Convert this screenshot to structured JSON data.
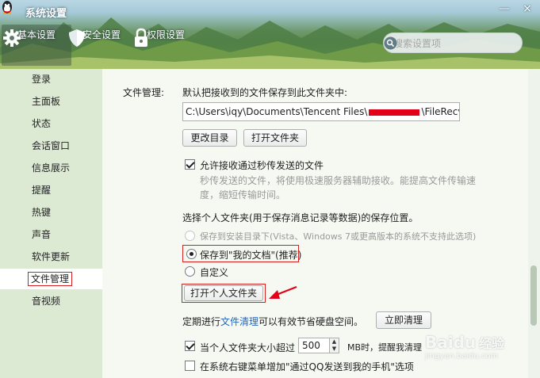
{
  "window": {
    "title": "系统设置",
    "minimize": "—",
    "close": "×"
  },
  "tabs": [
    {
      "label": "基本设置",
      "icon": "gear-icon"
    },
    {
      "label": "安全设置",
      "icon": "shield-icon"
    },
    {
      "label": "权限设置",
      "icon": "lock-icon"
    }
  ],
  "search": {
    "placeholder": "搜索设置项"
  },
  "sidebar": {
    "items": [
      {
        "label": "登录"
      },
      {
        "label": "主面板"
      },
      {
        "label": "状态"
      },
      {
        "label": "会话窗口"
      },
      {
        "label": "信息展示"
      },
      {
        "label": "提醒"
      },
      {
        "label": "热键"
      },
      {
        "label": "声音"
      },
      {
        "label": "软件更新"
      },
      {
        "label": "文件管理"
      },
      {
        "label": "音视频"
      }
    ],
    "active_index": 9
  },
  "file_mgmt": {
    "section_label": "文件管理:",
    "description": "默认把接收到的文件保存到此文件夹中:",
    "path_prefix": "C:\\Users\\iqy\\Documents\\Tencent Files\\",
    "path_suffix": "\\FileRecv\\",
    "change_dir_button": "更改目录",
    "open_folder_button": "打开文件夹",
    "allow_fast_transfer_label": "允许接收通过秒传发送的文件",
    "fast_transfer_desc_line1": "秒传发送的文件，将使用极速服务器辅助接收。能提高文件传输速",
    "fast_transfer_desc_line2": "度，缩短传输时间。",
    "folder_select_label": "选择个人文件夹(用于保存消息记录等数据)的保存位置。",
    "option_install_dir": "保存到安装目录下(Vista、Windows 7或更高版本的系统不支持此选项)",
    "option_my_docs": "保存到\"我的文档\"(推荐)",
    "option_custom": "自定义",
    "open_personal_folder_button": "打开个人文件夹",
    "cleanup_prefix": "定期进行",
    "cleanup_link": "文件清理",
    "cleanup_suffix": "可以有效节省硬盘空间。",
    "cleanup_now_button": "立即清理",
    "size_limit_prefix": "当个人文件夹大小超过",
    "size_limit_value": "500",
    "size_limit_suffix": "MB时，提醒我清理",
    "context_menu_label": "在系统右键菜单增加\"通过QQ发送到我的手机\"选项"
  },
  "watermark": {
    "brand": "Baidu",
    "sub": "经验",
    "url": "jingyan.baidu.com"
  },
  "colors": {
    "highlight_red": "#d62020",
    "link_blue": "#2766b8",
    "sidebar_bg": "#dcead4"
  }
}
